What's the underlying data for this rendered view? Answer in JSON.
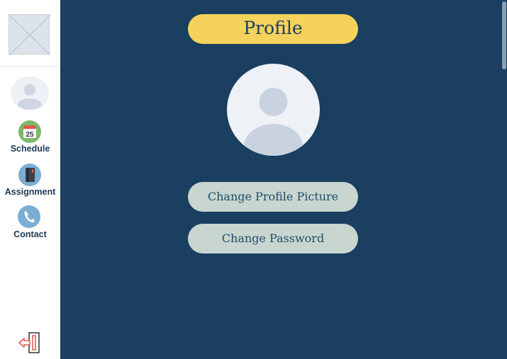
{
  "sidebar": {
    "items": [
      {
        "label": "Schedule",
        "icon": "calendar-icon",
        "badge": "25"
      },
      {
        "label": "Assignment",
        "icon": "book-icon"
      },
      {
        "label": "Contact",
        "icon": "phone-icon"
      }
    ],
    "logout_icon": "logout-icon"
  },
  "main": {
    "title": "Profile",
    "buttons": {
      "change_picture": "Change Profile Picture",
      "change_password": "Change Password"
    }
  },
  "colors": {
    "background": "#1a3f60",
    "title_pill": "#f5d25b",
    "action_button": "#c8d6cf",
    "sidebar": "#ffffff"
  }
}
